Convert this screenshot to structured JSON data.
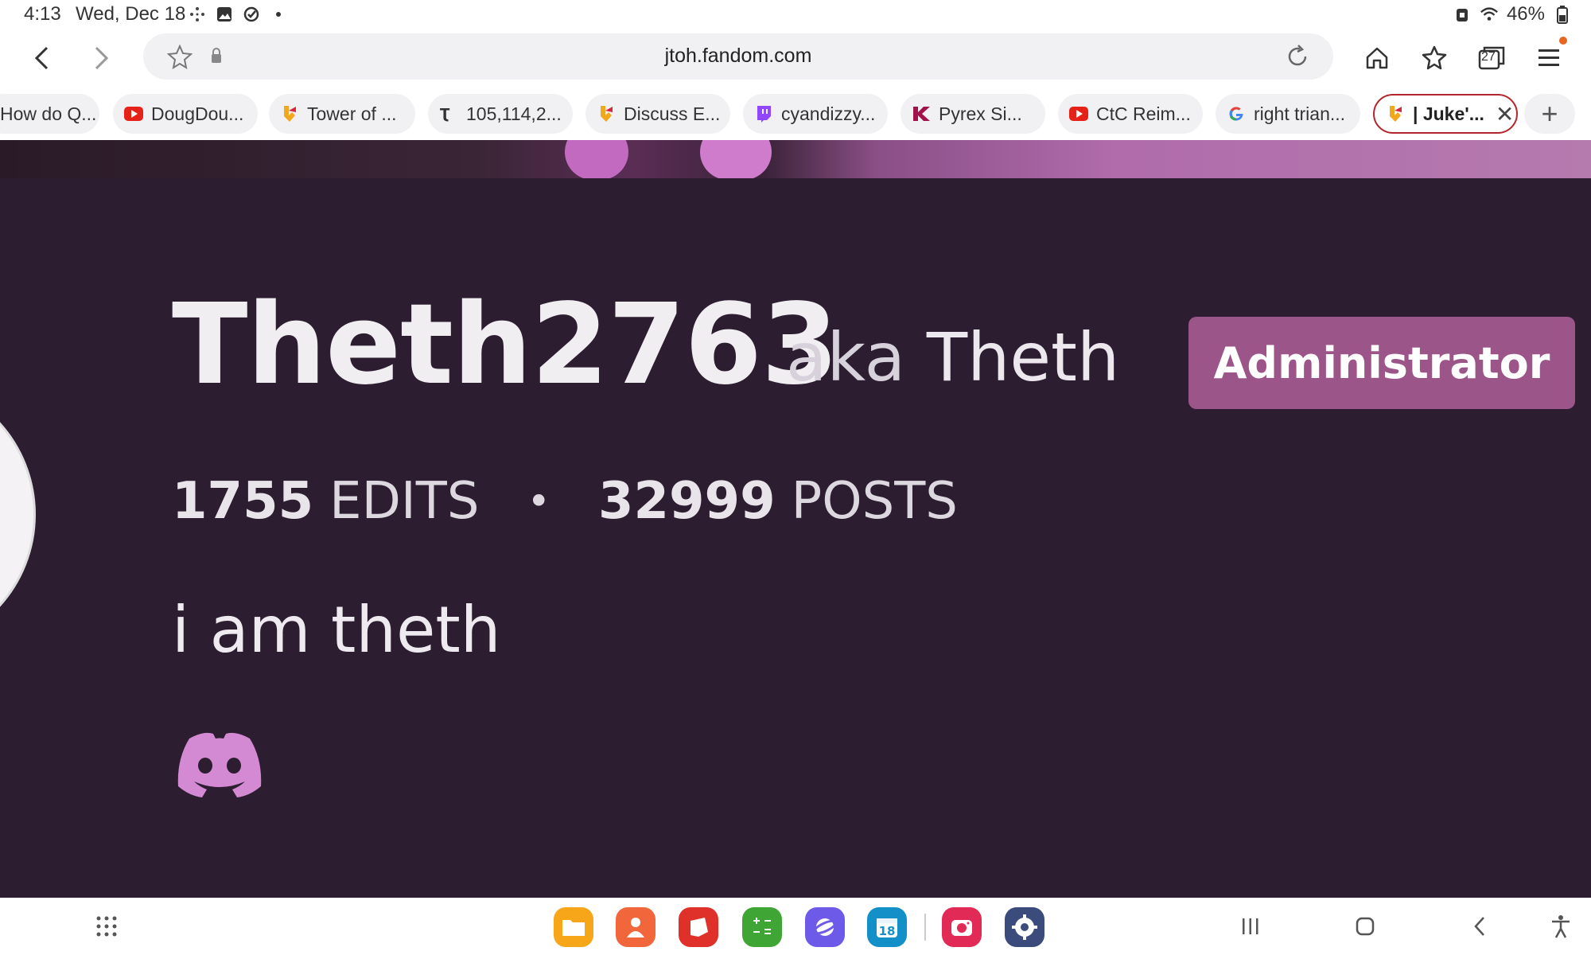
{
  "status_bar": {
    "time": "4:13",
    "date": "Wed, Dec 18",
    "battery": "46%"
  },
  "browser": {
    "url": "jtoh.fandom.com",
    "tab_count": "27",
    "tabs": [
      {
        "label": "How do Q...",
        "favicon": "none"
      },
      {
        "label": "DougDou...",
        "favicon": "youtube-icon"
      },
      {
        "label": "Tower of ...",
        "favicon": "fandom-icon"
      },
      {
        "label": "105,114,2...",
        "favicon": "oeis-icon"
      },
      {
        "label": "Discuss E...",
        "favicon": "fandom-icon"
      },
      {
        "label": "cyandizzy...",
        "favicon": "twitch-icon"
      },
      {
        "label": "Pyrex Si...",
        "favicon": "k-icon"
      },
      {
        "label": "CtC Reim...",
        "favicon": "youtube-icon"
      },
      {
        "label": "right trian...",
        "favicon": "google-icon"
      },
      {
        "label": "| Juke'...",
        "favicon": "fandom-icon",
        "active": true
      }
    ]
  },
  "profile": {
    "username": "Theth2763",
    "aka_word": "aka",
    "nickname": "Theth",
    "role_badge": "Administrator",
    "edits_count": "1755",
    "edits_label": "EDITS",
    "separator": "•",
    "posts_count": "32999",
    "posts_label": "POSTS",
    "bio": "i am theth"
  },
  "dock": {
    "calendar_day": "18"
  },
  "colors": {
    "page_bg": "#2c1d30",
    "badge": "#9c5588",
    "discord": "#d38ad3",
    "active_tab_border": "#b3262d"
  }
}
